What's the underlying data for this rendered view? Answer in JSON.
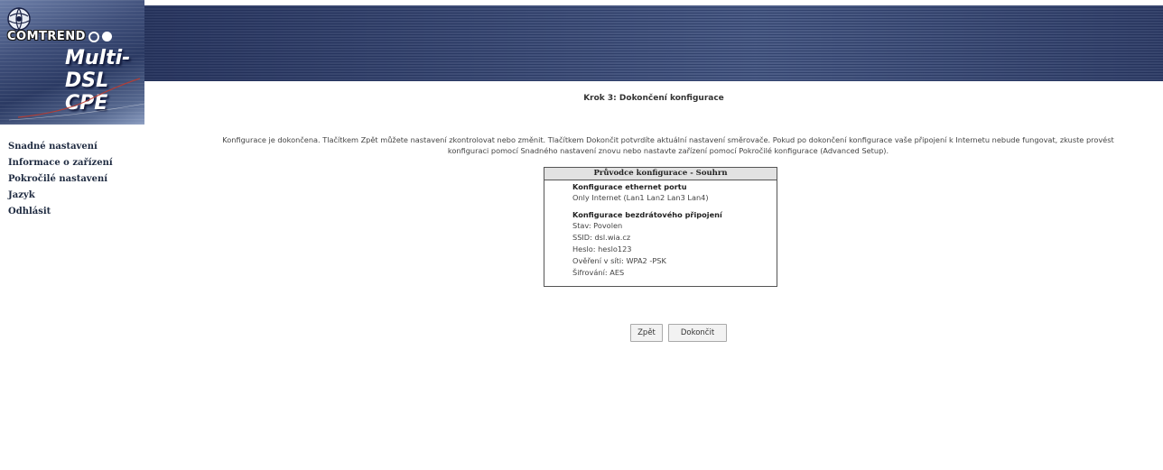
{
  "brand": {
    "company": "COMTREND",
    "product": "Multi-DSL CPE"
  },
  "sidebar": {
    "items": [
      {
        "label": "Snadné nastavení"
      },
      {
        "label": "Informace o zařízení"
      },
      {
        "label": "Pokročilé nastavení"
      },
      {
        "label": "Jazyk"
      },
      {
        "label": "Odhlásit"
      }
    ]
  },
  "main": {
    "step_title": "Krok 3: Dokončení konfigurace",
    "intro_line1": "Konfigurace je dokončena. Tlačítkem Zpět můžete nastavení zkontrolovat nebo změnit. Tlačítkem Dokončit potvrdíte aktuální nastavení směrovače. Pokud po dokončení konfigurace vaše připojení k Internetu nebude fungovat, zkuste provést",
    "intro_line2": "konfiguraci pomocí Snadného nastavení znovu nebo nastavte zařízení pomocí Pokročilé konfigurace (Advanced Setup).",
    "summary": {
      "header": "Průvodce konfigurace - Souhrn",
      "ethernet_title": "Konfigurace ethernet portu",
      "ethernet_value": "Only Internet (Lan1 Lan2 Lan3 Lan4)",
      "wireless_title": "Konfigurace bezdrátového připojení",
      "status": "Stav: Povolen",
      "ssid": "SSID: dsl.wia.cz",
      "password": "Heslo: heslo123",
      "auth": "Ověření v síti: WPA2 -PSK",
      "encryption": "Šifrování: AES"
    },
    "buttons": {
      "back": "Zpět",
      "finish": "Dokončit"
    }
  },
  "colors": {
    "banner_dark": "#30406a",
    "banner_light": "#4e5e86"
  }
}
